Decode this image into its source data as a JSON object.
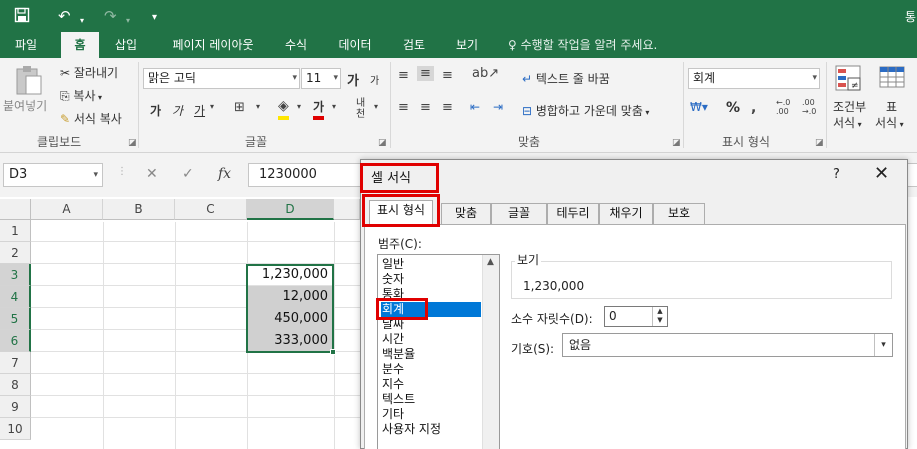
{
  "titlebar": {
    "save_icon": "save-icon",
    "undo_icon": "undo-icon",
    "redo_icon": "redo-icon",
    "customize_icon": "customize-qat-icon",
    "tail_text": "통"
  },
  "tabs": [
    "파일",
    "홈",
    "삽입",
    "페이지 레이아웃",
    "수식",
    "데이터",
    "검토",
    "보기"
  ],
  "active_tab": "홈",
  "tell_me": "수행할 작업을 알려 주세요.",
  "ribbon": {
    "clipboard": {
      "paste": "붙여넣기",
      "cut": "잘라내기",
      "copy": "복사",
      "format_painter": "서식 복사",
      "group": "클립보드"
    },
    "font": {
      "name": "맑은 고딕",
      "size": "11",
      "grow": "가",
      "shrink": "가",
      "bold": "가",
      "italic": "가",
      "underline": "가",
      "color": "가",
      "phonetic": "내천",
      "group": "글꼴"
    },
    "alignment": {
      "wrap": "텍스트 줄 바꿈",
      "merge": "병합하고 가운데 맞춤",
      "group": "맞춤"
    },
    "number": {
      "format": "회계",
      "percent": "%",
      "group": "표시 형식"
    },
    "styles": {
      "conditional_line1": "조건부",
      "conditional_line2": "서식",
      "table_line1": "표",
      "table_line2": "서식"
    }
  },
  "formula_bar": {
    "name_box": "D3",
    "fx": "fx",
    "value": "1230000"
  },
  "grid": {
    "columns": [
      "A",
      "B",
      "C",
      "D"
    ],
    "rows": [
      "1",
      "2",
      "3",
      "4",
      "5",
      "6",
      "7",
      "8",
      "9",
      "10"
    ],
    "d_cells": [
      "1,230,000",
      "12,000",
      "450,000",
      "333,000"
    ]
  },
  "dialog": {
    "title": "셀 서식",
    "help": "?",
    "tabs": [
      "표시 형식",
      "맞춤",
      "글꼴",
      "테두리",
      "채우기",
      "보호"
    ],
    "category_label": "범주(C):",
    "categories": [
      "일반",
      "숫자",
      "통화",
      "회계",
      "날짜",
      "시간",
      "백분율",
      "분수",
      "지수",
      "텍스트",
      "기타",
      "사용자 지정"
    ],
    "selected_category": "회계",
    "sample_label": "보기",
    "sample_value": "1,230,000",
    "decimal_label": "소수 자릿수(D):",
    "decimal_value": "0",
    "symbol_label": "기호(S):",
    "symbol_value": "없음"
  },
  "colors": {
    "excel_green": "#217346",
    "highlight_red": "#e00000",
    "selection_blue": "#0078d7"
  }
}
